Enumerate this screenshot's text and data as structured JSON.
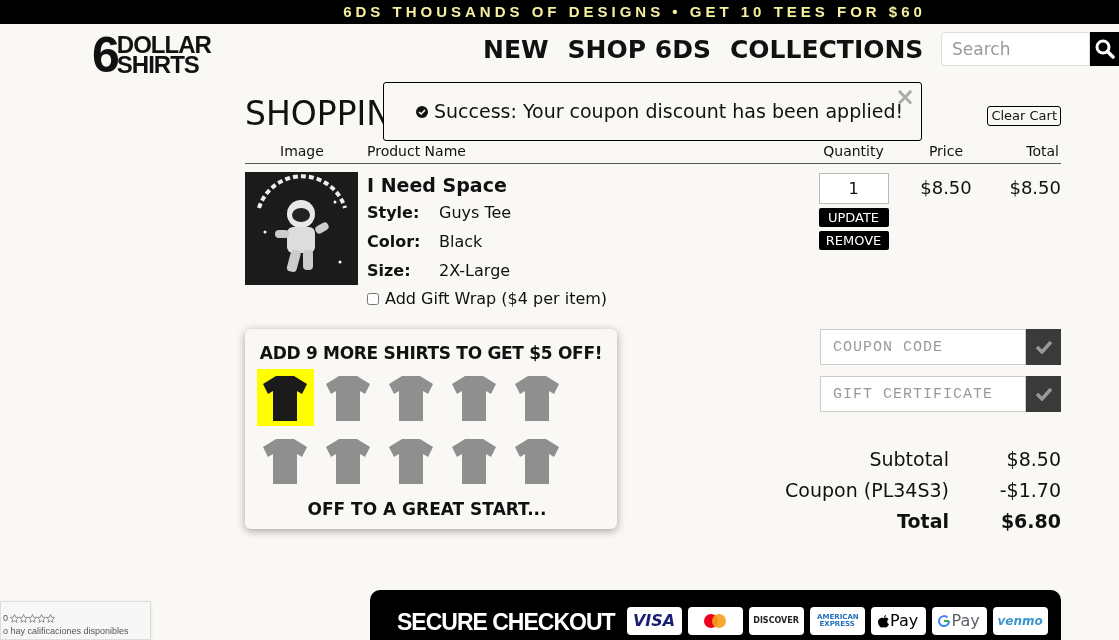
{
  "promo_bar": {
    "text": "6DS THOUSANDS OF DESIGNS • GET 10 TEES FOR $60"
  },
  "logo": {
    "numeral": "6",
    "line_1": "DOLLAR",
    "line_2": "SHIRTS"
  },
  "nav": [
    "NEW",
    "SHOP 6DS",
    "COLLECTIONS"
  ],
  "search": {
    "placeholder": "Search"
  },
  "page_title": "SHOPPIN",
  "toast": {
    "message": "Success: Your coupon discount has been applied!",
    "close": "×"
  },
  "clear_cart": "Clear Cart",
  "table": {
    "columns": [
      "Image",
      "Product Name",
      "Quantity",
      "Price",
      "Total"
    ],
    "rows": [
      {
        "name": "I Need Space",
        "details": [
          {
            "label": "Style:",
            "value": "Guys Tee"
          },
          {
            "label": "Color:",
            "value": "Black"
          },
          {
            "label": "Size:",
            "value": "2X-Large"
          }
        ],
        "gift_wrap": {
          "label": "Add Gift Wrap ($4 per item)",
          "checked": false
        },
        "quantity": "1",
        "update": "UPDATE",
        "remove": "REMOVE",
        "price": "$8.50",
        "total": "$8.50"
      }
    ]
  },
  "promo_tracker": {
    "title": "ADD 9 MORE SHIRTS TO GET $5 OFF!",
    "shirts": [
      {
        "filled": true
      },
      {
        "filled": false
      },
      {
        "filled": false
      },
      {
        "filled": false
      },
      {
        "filled": false
      },
      {
        "filled": false
      },
      {
        "filled": false
      },
      {
        "filled": false
      },
      {
        "filled": false
      },
      {
        "filled": false
      }
    ],
    "message": "OFF TO A GREAT START..."
  },
  "codes": [
    {
      "placeholder": "COUPON CODE"
    },
    {
      "placeholder": "GIFT CERTIFICATE"
    }
  ],
  "totals": [
    {
      "label": "Subtotal",
      "value": "$8.50",
      "bold": false
    },
    {
      "label": "Coupon (PL34S3)",
      "value": "-$1.70",
      "bold": false
    },
    {
      "label": "Total",
      "value": "$6.80",
      "bold": true
    }
  ],
  "checkout": {
    "title": "SECURE CHECKOUT",
    "methods": [
      {
        "kind": "visa",
        "label": "VISA"
      },
      {
        "kind": "mastercard"
      },
      {
        "kind": "discover",
        "label": "DISCOVER"
      },
      {
        "kind": "amex",
        "label": "AMERICAN EXPRESS"
      },
      {
        "kind": "applepay",
        "label": "Pay"
      },
      {
        "kind": "googlepay",
        "label": "Pay"
      },
      {
        "kind": "venmo",
        "label": "venmo"
      }
    ]
  },
  "reviews_widget": {
    "count": "0",
    "stars": 0,
    "text": "o hay calificaciones disponibles"
  }
}
